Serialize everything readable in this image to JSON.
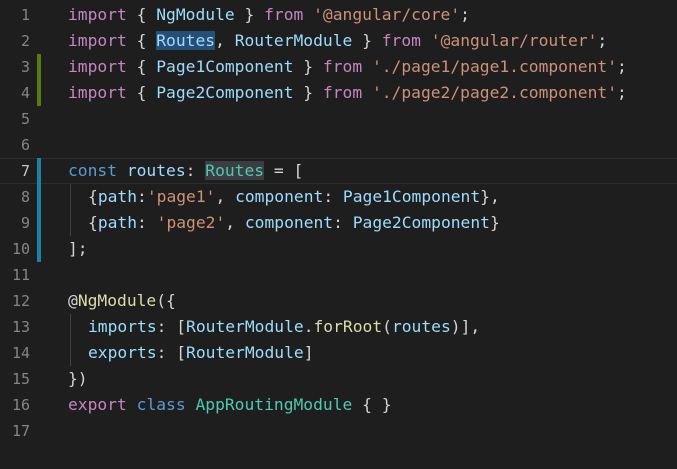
{
  "editor": {
    "line_numbers": [
      "1",
      "2",
      "3",
      "4",
      "5",
      "6",
      "7",
      "8",
      "9",
      "10",
      "11",
      "12",
      "13",
      "14",
      "15",
      "16",
      "17"
    ],
    "line1": {
      "kw": "import",
      "open": " { ",
      "name": "NgModule",
      "close": " } ",
      "from": "from",
      "sp": " ",
      "path": "'@angular/core'",
      "end": ";"
    },
    "line2": {
      "kw": "import",
      "open": " { ",
      "name1": "Routes",
      "comma": ", ",
      "name2": "RouterModule",
      "close": " } ",
      "from": "from",
      "sp": " ",
      "path": "'@angular/router'",
      "end": ";"
    },
    "line3": {
      "kw": "import",
      "open": " { ",
      "name": "Page1Component",
      "close": " } ",
      "from": "from",
      "sp": " ",
      "path": "'./page1/page1.component'",
      "end": ";"
    },
    "line4": {
      "kw": "import",
      "open": " { ",
      "name": "Page2Component",
      "close": " } ",
      "from": "from",
      "sp": " ",
      "path": "'./page2/page2.component'",
      "end": ";"
    },
    "line7": {
      "kw": "const",
      "sp": " ",
      "var": "routes",
      "colon": ": ",
      "type": "Routes",
      "rest": " = ["
    },
    "line8": {
      "open": "{",
      "key1": "path",
      "colon1": ":",
      "val1": "'page1'",
      "comma1": ", ",
      "key2": "component",
      "colon2": ": ",
      "val2": "Page1Component",
      "close": "},"
    },
    "line9": {
      "open": "{",
      "key1": "path",
      "colon1": ": ",
      "val1": "'page2'",
      "comma1": ", ",
      "key2": "component",
      "colon2": ": ",
      "val2": "Page2Component",
      "close": "}"
    },
    "line10": {
      "text": "];"
    },
    "line12": {
      "at": "@",
      "deco": "NgModule",
      "rest": "({"
    },
    "line13": {
      "key": "imports",
      "colon": ": [",
      "cls": "RouterModule",
      "dot": ".",
      "fn": "forRoot",
      "paren": "(",
      "arg": "routes",
      "rest": ")],"
    },
    "line14": {
      "key": "exports",
      "colon": ": [",
      "cls": "RouterModule",
      "rest": "]"
    },
    "line15": {
      "text": "})"
    },
    "line16": {
      "kw1": "export",
      "sp1": " ",
      "kw2": "class",
      "sp2": " ",
      "name": "AppRoutingModule",
      "rest": " { }"
    }
  },
  "colors": {
    "background": "#1e1e1e",
    "keyword": "#569cd6",
    "import_keyword": "#c586c0",
    "string": "#ce9178",
    "variable": "#9cdcfe",
    "type": "#4ec9b0",
    "function": "#dcdcaa",
    "line_number": "#858585",
    "diff_added": "#587c0c",
    "diff_modified": "#1b81a8",
    "selection": "#264f78"
  }
}
